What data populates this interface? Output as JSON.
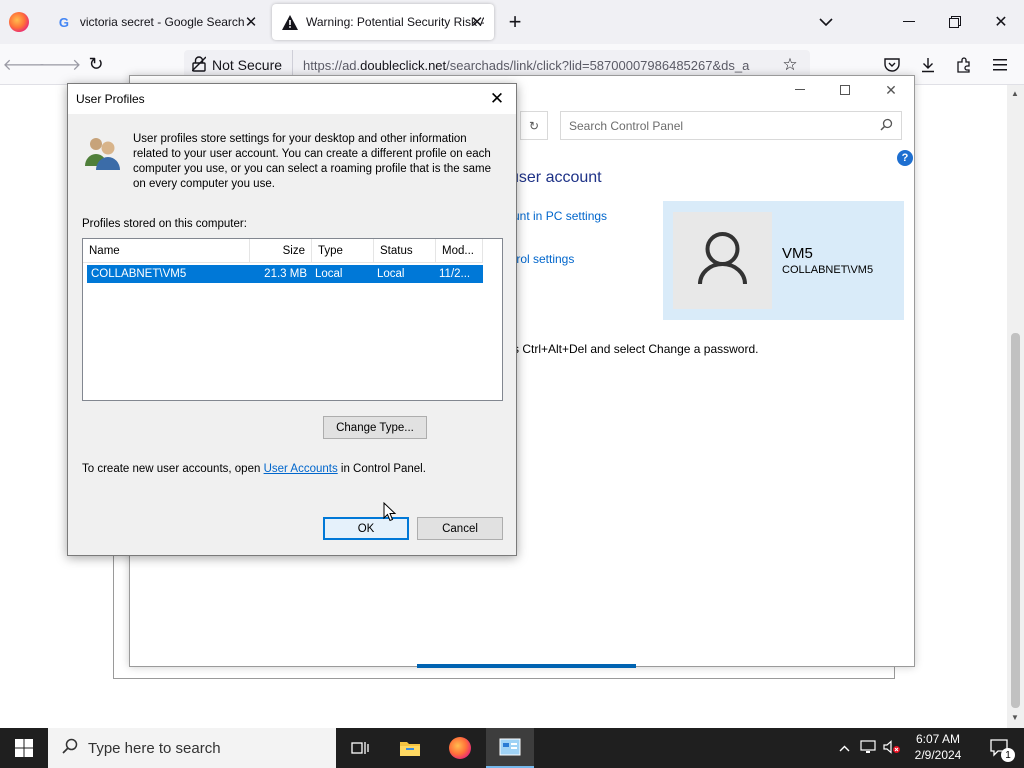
{
  "browser": {
    "tabs": [
      {
        "title": "victoria secret - Google Search",
        "icon": "google-icon"
      },
      {
        "title": "Warning: Potential Security Risk Ahead",
        "icon": "warning-icon"
      }
    ],
    "security_label": "Not Secure",
    "url_prefix": "https://ad.",
    "url_domain": "doubleclick.net",
    "url_rest": "/searchads/link/click?lid=58700007986485267&ds_a"
  },
  "control_panel": {
    "search_placeholder": "Search Control Panel",
    "heading": "user account",
    "link1": "unt in PC settings",
    "link2": "trol settings",
    "hint": "s Ctrl+Alt+Del and select Change a password.",
    "user": {
      "name": "VM5",
      "domain": "COLLABNET\\VM5"
    },
    "help": "?"
  },
  "dialog": {
    "title": "User Profiles",
    "description": "User profiles store settings for your desktop and other information related to your user account. You can create a different profile on each computer you use, or you can select a roaming profile that is the same on every computer you use.",
    "profiles_label": "Profiles stored on this computer:",
    "columns": [
      "Name",
      "Size",
      "Type",
      "Status",
      "Mod..."
    ],
    "rows": [
      {
        "name": "COLLABNET\\VM5",
        "size": "21.3 MB",
        "type": "Local",
        "status": "Local",
        "modified": "11/2..."
      }
    ],
    "change_type_label": "Change Type...",
    "note_before": "To create new user accounts, open ",
    "note_link": "User Accounts",
    "note_after": " in Control Panel.",
    "ok_label": "OK",
    "cancel_label": "Cancel"
  },
  "taskbar": {
    "search_placeholder": "Type here to search",
    "time": "6:07 AM",
    "date": "2/9/2024",
    "notification_count": "1"
  }
}
